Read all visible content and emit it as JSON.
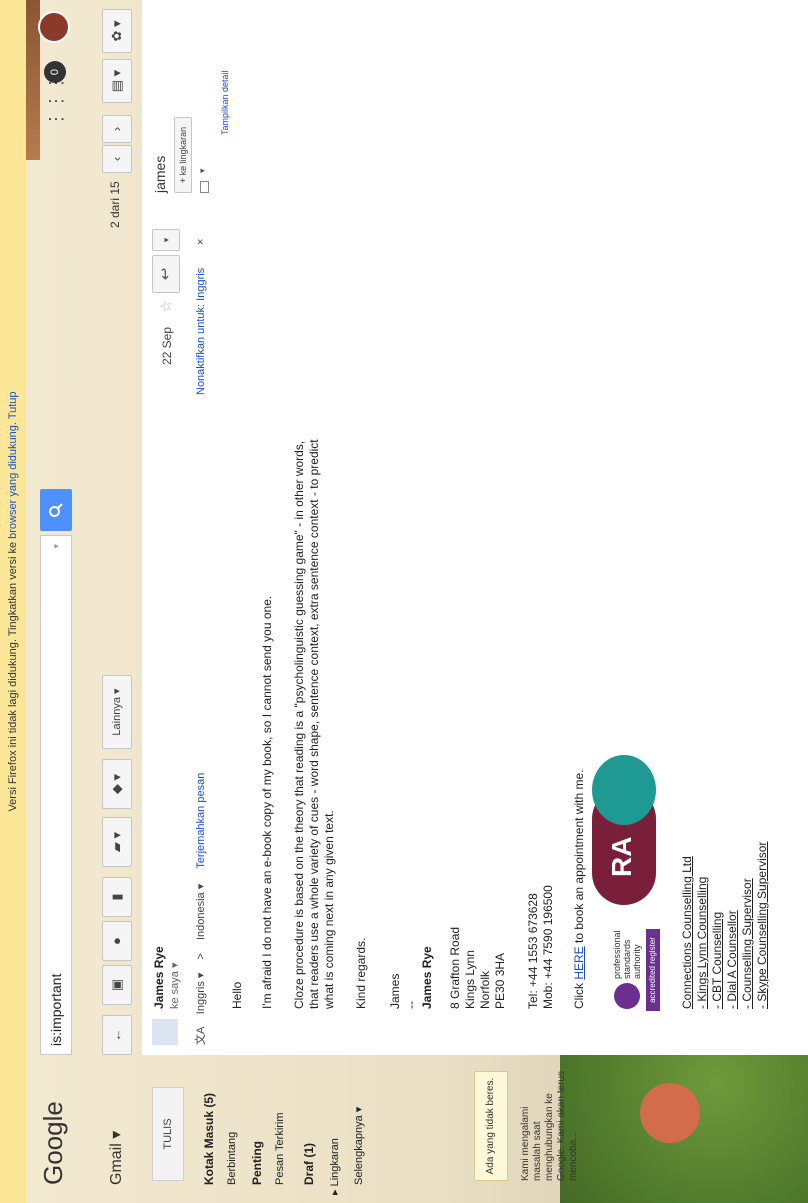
{
  "banner": {
    "text": "Versi Firefox ini tidak lagi didukung. Tingkatkan versi ke",
    "link": "browser yang didukung.",
    "close": "Tutup"
  },
  "header": {
    "logo": "Google",
    "search_value": "is:important",
    "search_caret": "▾",
    "search_icon": "search-icon",
    "apps_icon": "apps-icon",
    "notif": "0"
  },
  "toolbar": {
    "gmail_label": "Gmail ▾",
    "back": "←",
    "archive": "▣",
    "spam": "●",
    "delete": "▮",
    "folder": "▰ ▾",
    "label": "◆ ▾",
    "more": "Lainnya ▾",
    "page_info": "2 dari 15",
    "prev": "‹",
    "next": "›",
    "keyboard": "▤ ▾",
    "settings": "✿ ▾"
  },
  "nav": {
    "compose": "TULIS",
    "items": [
      "Kotak Masuk (5)",
      "Berbintang",
      "Penting",
      "Pesan Terkirim",
      "Draf (1)",
      "▸ Lingkaran",
      "Selengkapnya ▾"
    ],
    "warning": "Ada yang tidak beres.",
    "message": [
      "Kami mengalami",
      "masalah saat",
      "menghubungkan ke",
      "Google. Kami akan terus",
      "mencoba..."
    ]
  },
  "message": {
    "sender": "James Rye",
    "to": "ke saya ▾",
    "date": "22 Sep",
    "star": "☆",
    "reply": "↩",
    "more": "▾",
    "translate": {
      "lang_from": "Inggris ▾",
      "arrow": ">",
      "lang_to": "Indonesia ▾",
      "translate_link": "Terjemahkan pesan",
      "disable_link": "Nonaktifkan untuk: Inggris",
      "close": "×"
    },
    "body": [
      "Hello",
      "I'm afraid I do not have an e-book copy of my book, so I cannot send you one.",
      "Cloze procedure is based on the theory that reading is a \"psycholinguistic guessing game\" - in other words,",
      "that readers use a whole variety of cues - word shape, sentence context, extra sentence context - to predict",
      "what is coming next in any given text.",
      "Kind regards.",
      "James",
      "--",
      "James Rye",
      "8 Grafton Road",
      "Kings Lynn",
      "Norfolk",
      "PE30 3HA",
      "Tel: +44 1553 673628",
      "Mob: +44 7590 196500",
      "to book an appointment with me."
    ],
    "click": "Click",
    "here": "HERE",
    "psa": [
      "professional",
      "standards",
      "authority"
    ],
    "psa_reg": "accredited register",
    "rva": "RA",
    "footer": [
      "Connections Counselling Ltd",
      "- Kings Lynn Counselling",
      "- CBT Counselling",
      "- Dial A Counsellor",
      "- Counselling Supervisor",
      "- Skype Counselling Supervisor"
    ]
  },
  "contact": {
    "name": "james",
    "add_circle": "+ ke lingkaran",
    "details": "Tampilkan detail",
    "mail_arrow": "▾"
  }
}
